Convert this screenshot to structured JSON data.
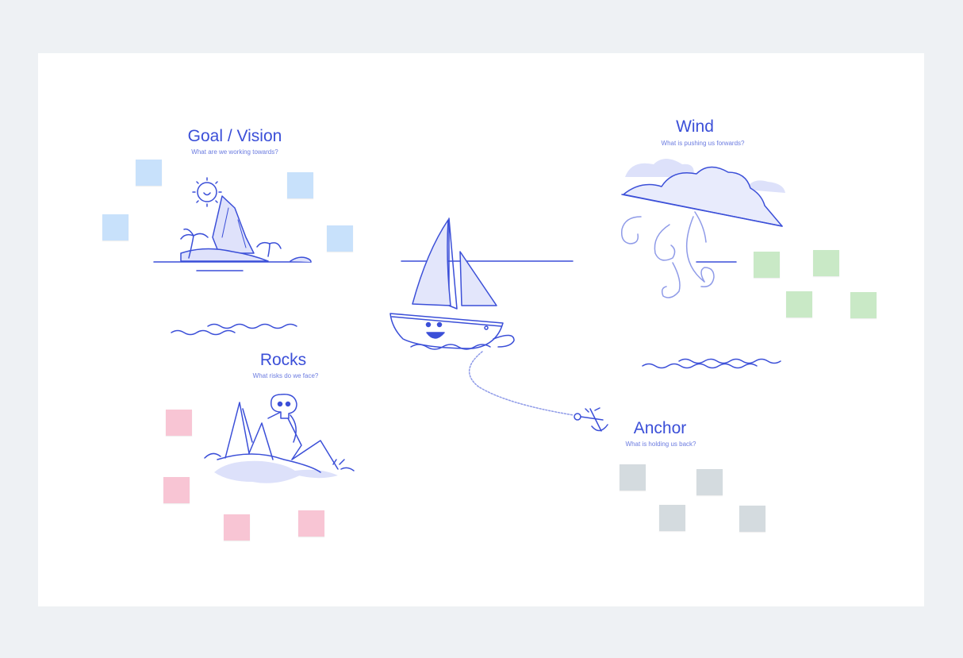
{
  "board": {
    "sections": {
      "goal": {
        "title": "Goal / Vision",
        "subtitle": "What are we working towards?"
      },
      "wind": {
        "title": "Wind",
        "subtitle": "What is pushing us forwards?"
      },
      "rocks": {
        "title": "Rocks",
        "subtitle": "What risks do we face?"
      },
      "anchor": {
        "title": "Anchor",
        "subtitle": "What is holding us back?"
      }
    },
    "sticky_colors": {
      "goal": "#c8e1fb",
      "wind": "#c9e9c6",
      "rocks": "#f8c5d4",
      "anchor": "#d4dbdf"
    },
    "illustrations": [
      "island-icon",
      "sun-icon",
      "sailboat-icon",
      "cloud-wind-icon",
      "rocks-skull-icon",
      "anchor-icon"
    ],
    "accent_color": "#3b4fd8"
  }
}
